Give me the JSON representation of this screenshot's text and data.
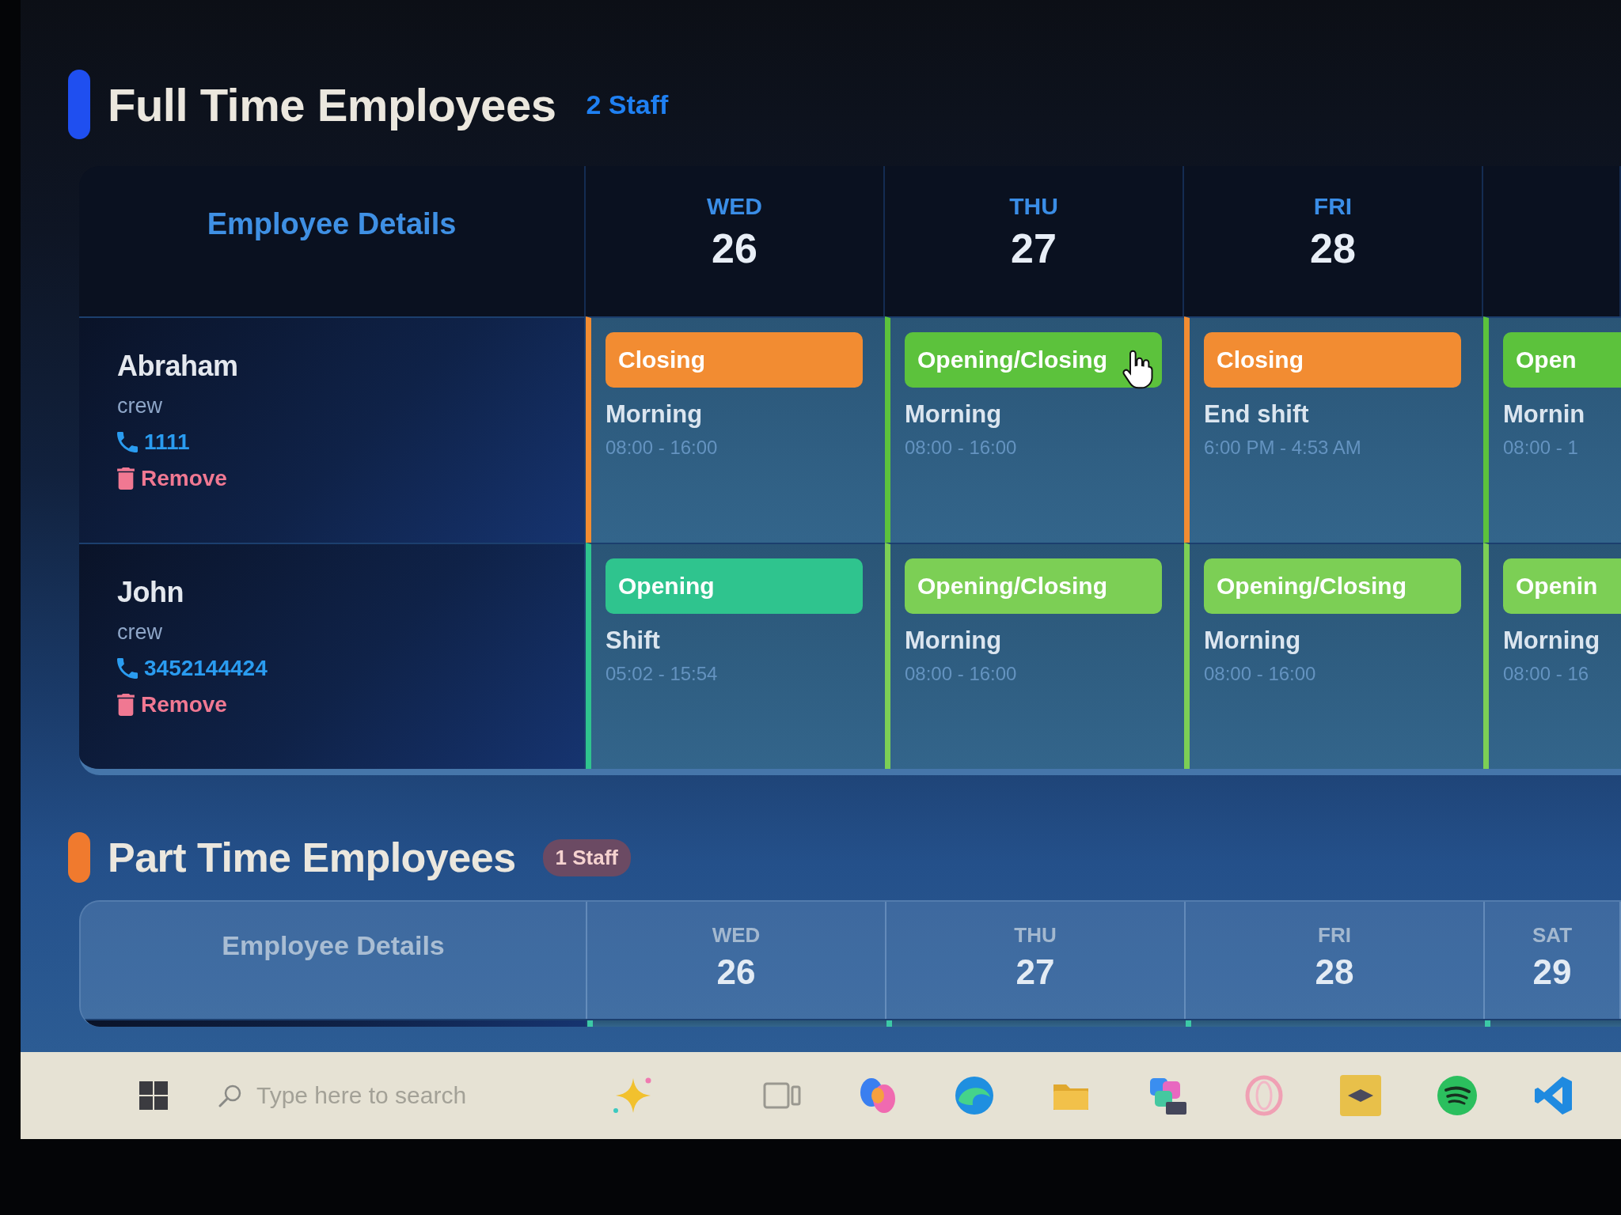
{
  "sections": [
    {
      "kind": "full_time",
      "title": "Full Time Employees",
      "count": "2 Staff",
      "color": "#1f4ff0",
      "table": {
        "details_heading": "Employee Details",
        "days": [
          {
            "weekday": "WED",
            "date": "26"
          },
          {
            "weekday": "THU",
            "date": "27"
          },
          {
            "weekday": "FRI",
            "date": "28"
          }
        ],
        "employees": [
          {
            "name": "Abraham",
            "role": "crew",
            "phone": "1111",
            "action": "Remove",
            "shifts": [
              {
                "label": "Closing",
                "color": "#f28c32",
                "title": "Morning",
                "time": "08:00 - 16:00"
              },
              {
                "label": "Opening/Closing",
                "color": "#5cc23c",
                "title": "Morning",
                "time": "08:00 - 16:00"
              },
              {
                "label": "Closing",
                "color": "#f28c32",
                "title": "End shift",
                "time": "6:00 PM - 4:53 AM"
              },
              {
                "label": "Open",
                "color": "#5cc23c",
                "title": "Mornin",
                "time": "08:00 - 1"
              }
            ]
          },
          {
            "name": "John",
            "role": "crew",
            "phone": "3452144424",
            "action": "Remove",
            "shifts": [
              {
                "label": "Opening",
                "color": "#2fc48e",
                "title": "Shift",
                "time": "05:02 - 15:54"
              },
              {
                "label": "Opening/Closing",
                "color": "#7ccf55",
                "title": "Morning",
                "time": "08:00 - 16:00"
              },
              {
                "label": "Opening/Closing",
                "color": "#7ccf55",
                "title": "Morning",
                "time": "08:00 - 16:00"
              },
              {
                "label": "Openin",
                "color": "#7ccf55",
                "title": "Morning",
                "time": "08:00 - 16"
              }
            ]
          }
        ]
      }
    },
    {
      "kind": "part_time",
      "title": "Part Time Employees",
      "count": "1 Staff",
      "color": "#f07a2e",
      "table": {
        "details_heading": "Employee Details",
        "days": [
          {
            "weekday": "WED",
            "date": "26"
          },
          {
            "weekday": "THU",
            "date": "27"
          },
          {
            "weekday": "FRI",
            "date": "28"
          },
          {
            "weekday": "SAT",
            "date": "29"
          }
        ],
        "employees": [
          {
            "shifts": [
              {
                "color": "#3cc9a6"
              },
              {
                "color": "#3cc9a6"
              },
              {
                "color": "#3cc9a6"
              },
              {
                "color": "#3cc9a6"
              }
            ]
          }
        ]
      }
    }
  ],
  "taskbar": {
    "search": {
      "placeholder": "Type here to search"
    }
  }
}
